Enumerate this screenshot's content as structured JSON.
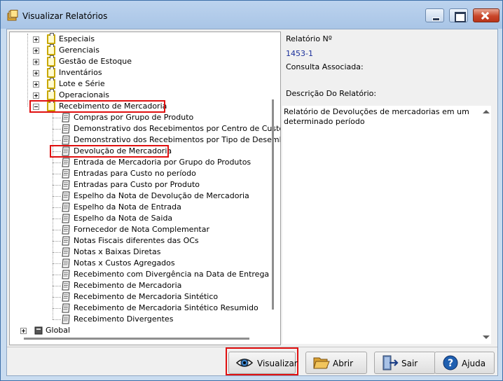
{
  "window": {
    "title": "Visualizar Relatórios"
  },
  "tree": {
    "folders": [
      {
        "label": "Especiais",
        "expanded": false
      },
      {
        "label": "Gerenciais",
        "expanded": false
      },
      {
        "label": "Gestão de Estoque",
        "expanded": false
      },
      {
        "label": "Inventários",
        "expanded": false
      },
      {
        "label": "Lote e Série",
        "expanded": false
      },
      {
        "label": "Operacionais",
        "expanded": false
      },
      {
        "label": "Recebimento de Mercadoria",
        "expanded": true
      }
    ],
    "reports": [
      "Compras por Grupo de Produto",
      "Demonstrativo dos Recebimentos por Centro de Custo",
      "Demonstrativo dos Recebimentos por Tipo de Desembolso",
      "Devolução de Mercadoria",
      "Entrada de Mercadoria por Grupo do Produtos",
      "Entradas para Custo no período",
      "Entradas para Custo por Produto",
      "Espelho da Nota de Devolução de Mercadoria",
      "Espelho da Nota de Entrada",
      "Espelho da Nota de Saida",
      "Fornecedor de Nota Complementar",
      "Notas Fiscais diferentes das OCs",
      "Notas x Baixas Diretas",
      "Notas x Custos Agregados",
      "Recebimento com Divergência na Data de Entrega",
      "Recebimento de Mercadoria",
      "Recebimento de Mercadoria Sintético",
      "Recebimento de Mercadoria Sintético Resumido",
      "Recebimento Divergentes"
    ],
    "selected_report": "Devolução de Mercadoria",
    "global_label": "Global"
  },
  "details": {
    "report_number_label": "Relatório Nº",
    "report_number_value": "1453-1",
    "associated_query_label": "Consulta Associada:",
    "description_label": "Descrição Do Relatório:",
    "description_text": "Relatório de Devoluções de mercadorias em um determinado período"
  },
  "buttons": {
    "visualizar": "Visualizar",
    "abrir": "Abrir",
    "sair": "Sair",
    "ajuda": "Ajuda"
  },
  "colors": {
    "highlight": "#e01010",
    "value_text": "#1a2f9a",
    "folder": "#c9a800"
  }
}
